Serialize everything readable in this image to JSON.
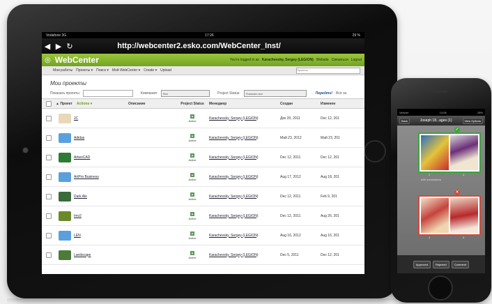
{
  "browser": {
    "status_left": "Vodafone 3G",
    "status_time": "17:26",
    "status_right": "29 %",
    "back": "◀",
    "forward": "▶",
    "reload": "↻",
    "url": "http://webcenter2.esko.com/WebCenter_Inst/"
  },
  "webcenter": {
    "logo": "WebCenter",
    "logged_in_prefix": "You're logged in as",
    "user": "Karachevsky, Sergey (LEGION)",
    "links": [
      "Website",
      "Связаться",
      "Logout"
    ],
    "menu": [
      "Мои работы",
      "Проекты ▾",
      "Поиск ▾",
      "Мой WebCenter ▾",
      "Create ▾",
      "Upload"
    ],
    "search_placeholder": "Проекты"
  },
  "page": {
    "title": "Мои проекты",
    "filter_show": "Показать проекты",
    "filter_company": "Компания:",
    "filter_company_value": "Все",
    "filter_status": "Project Status:",
    "filter_status_value": "Показать все",
    "go": "Перейти!",
    "all": "Всё за"
  },
  "table": {
    "headers": [
      "▲ Проект",
      "Actions ▾",
      "Описание",
      "Project Status",
      "Менеджер",
      "Создан",
      "Изменен"
    ],
    "rows": [
      {
        "name": "JC",
        "status": "Active",
        "manager": "Karachevsky, Sergey (LEGION)",
        "created": "Дек 20, 2011",
        "modified": "Dec 12, 201",
        "thumb": "#e9d8b8"
      },
      {
        "name": "Adidas",
        "status": "Active",
        "manager": "Karachevsky, Sergey (LEGION)",
        "created": "Май 23, 2012",
        "modified": "Май 23, 201",
        "thumb": "#5aa0dc"
      },
      {
        "name": "ArtwoCAD",
        "status": "Active",
        "manager": "Karachevsky, Sergey (LEGION)",
        "created": "Dec 12, 2011",
        "modified": "Dec 12, 201",
        "thumb": "#2f7a35"
      },
      {
        "name": "ArtPro Business",
        "status": "Active",
        "manager": "Karachevsky, Sergey (LEGION)",
        "created": "Aug 17, 2012",
        "modified": "Aug 18, 201",
        "thumb": "#5aa0dc"
      },
      {
        "name": "Dark Ale",
        "status": "Active",
        "manager": "Karachevsky, Sergey (LEGION)",
        "created": "Dec 12, 2011",
        "modified": "Feb 9, 201",
        "thumb": "#3a6b3a"
      },
      {
        "name": "Imv2",
        "status": "Active",
        "manager": "Karachevsky, Sergey (LEGION)",
        "created": "Dec 12, 2011",
        "modified": "Aug 26, 201",
        "thumb": "#6a8a2a"
      },
      {
        "name": "LEN",
        "status": "Active",
        "manager": "Karachevsky, Sergey (LEGION)",
        "created": "Aug 16, 2012",
        "modified": "Aug 16, 201",
        "thumb": "#5aa0dc"
      },
      {
        "name": "Landscape",
        "status": "Active",
        "manager": "Karachevsky, Sergey (LEGION)",
        "created": "Dec 5, 2011",
        "modified": "Dec 12, 201",
        "thumb": "#4e7a3a"
      }
    ]
  },
  "phone": {
    "status_left": "Verizon",
    "status_time": "13:06",
    "status_right": "28%",
    "back": "Back",
    "title": "Joseph 18...ages (1)",
    "options": "View Options",
    "page_num_top_left": "2",
    "page_num_top_right": "3",
    "page_caption": "with annotations",
    "page_num_bot_left": "4",
    "page_num_bot_right": "5",
    "approved": "Approved",
    "rejected": "Rejected",
    "comment": "Comment"
  }
}
